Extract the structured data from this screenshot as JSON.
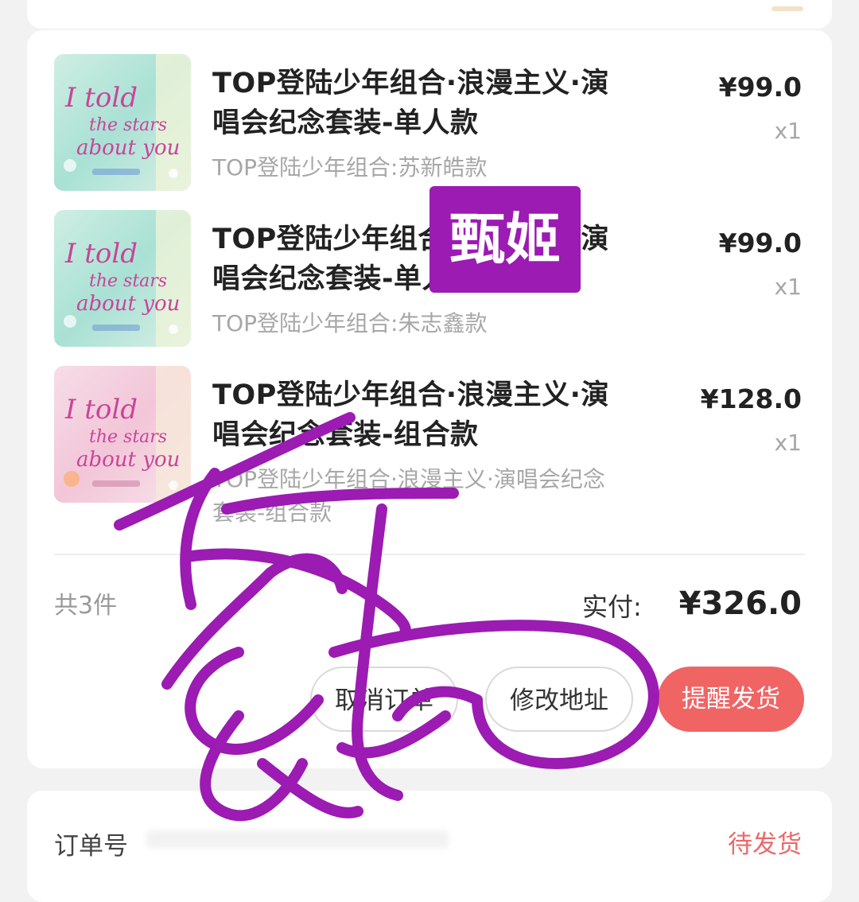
{
  "products": [
    {
      "title": "TOP登陆少年组合·浪漫主义·演唱会纪念套装-单人款",
      "spec": "TOP登陆少年组合:苏新皓款",
      "price": "¥99.0",
      "qty": "x1",
      "cover_theme": "mint",
      "cover_text": "I told the stars about you"
    },
    {
      "title": "TOP登陆少年组合·浪漫主义·演唱会纪念套装-单人款",
      "spec": "TOP登陆少年组合:朱志鑫款",
      "price": "¥99.0",
      "qty": "x1",
      "cover_theme": "mint",
      "cover_text": "I told the stars about you"
    },
    {
      "title": "TOP登陆少年组合·浪漫主义·演唱会纪念套装-组合款",
      "spec": "TOP登陆少年组合·浪漫主义·演唱会纪念套装-组合款",
      "price": "¥128.0",
      "qty": "x1",
      "cover_theme": "pink",
      "cover_text": "I told the stars about you"
    }
  ],
  "summary": {
    "count": "共3件",
    "paid_label": "实付:",
    "paid_amount": "¥326.0"
  },
  "actions": {
    "cancel": "取消订单",
    "modify_address": "修改地址",
    "remind": "提醒发货"
  },
  "order_info": {
    "order_no_label": "订单号",
    "status": "待发货"
  },
  "watermark": {
    "box_text": "甄姬"
  },
  "colors": {
    "accent": "#f06464",
    "watermark": "#9b1bb3",
    "status": "#e96a6a"
  }
}
